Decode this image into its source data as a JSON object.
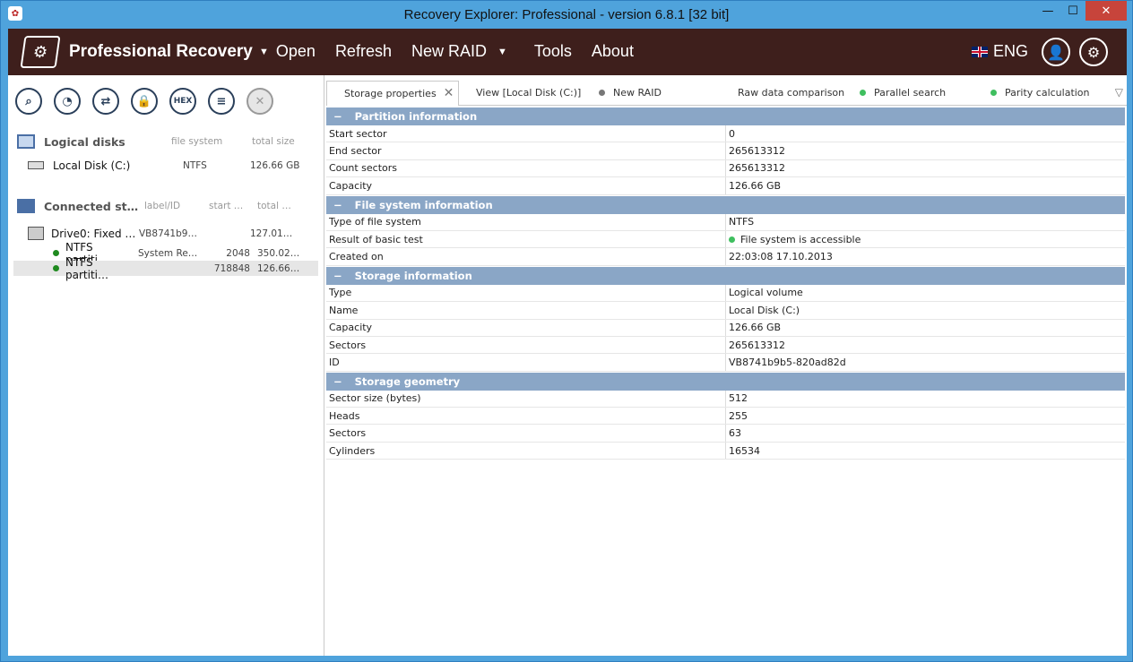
{
  "window": {
    "title": "Recovery Explorer: Professional - version 6.8.1 [32 bit]",
    "minimize_glyph": "—",
    "maximize_glyph": "☐",
    "close_glyph": "✕"
  },
  "header": {
    "brand": "Professional Recovery",
    "menu": [
      {
        "label": "Open",
        "caret": "▼"
      },
      {
        "label": "Refresh",
        "caret": ""
      },
      {
        "label": "New RAID",
        "caret": "▼"
      },
      {
        "label": "Tools",
        "caret": ""
      },
      {
        "label": "About",
        "caret": ""
      }
    ],
    "language": "ENG",
    "user_glyph": "👤",
    "settings_glyph": "⚙"
  },
  "toolbar": {
    "hex_label": "HEX",
    "search_glyph": "⌕",
    "scan_glyph": "◔",
    "image_glyph": "⇄",
    "lock_glyph": "🔒",
    "list_glyph": "≡",
    "close_glyph": "✕"
  },
  "logical": {
    "title": "Logical disks",
    "col_fs": "file system",
    "col_size": "total size",
    "items": [
      {
        "name": "Local Disk (C:)",
        "fs": "NTFS",
        "size": "126.66 GB"
      }
    ]
  },
  "connected": {
    "title": "Connected st…",
    "col_label": "label/ID",
    "col_start": "start …",
    "col_total": "total …",
    "drive": {
      "name": "Drive0: Fixed …",
      "label": "VB8741b9…",
      "total": "127.01…"
    },
    "partitions": [
      {
        "name": "NTFS partiti…",
        "label": "System Re…",
        "start": "2048",
        "total": "350.02…"
      },
      {
        "name": "NTFS partiti…",
        "label": "",
        "start": "718848",
        "total": "126.66…"
      }
    ]
  },
  "tabs": [
    {
      "label": "Storage properties",
      "dot": "#777777",
      "closable": true
    },
    {
      "label": "View [Local Disk (C:)]",
      "dot": "#3fbf5f",
      "closable": false
    },
    {
      "label": "New RAID",
      "dot": "#777777",
      "closable": false
    },
    {
      "label": "Raw data comparison",
      "dot": "#3fbf5f",
      "closable": false
    },
    {
      "label": "Parallel search",
      "dot": "#3fbf5f",
      "closable": false
    },
    {
      "label": "Parity calculation",
      "dot": "#3fbf5f",
      "closable": false
    }
  ],
  "tab_menu_glyph": "▽",
  "groups": [
    {
      "title": "Partition information",
      "rows": [
        {
          "k": "Start sector",
          "v": "0"
        },
        {
          "k": "End sector",
          "v": "265613312"
        },
        {
          "k": "Count sectors",
          "v": "265613312"
        },
        {
          "k": "Capacity",
          "v": "126.66 GB"
        }
      ]
    },
    {
      "title": "File system information",
      "rows": [
        {
          "k": "Type of file system",
          "v": "NTFS"
        },
        {
          "k": "Result of basic test",
          "v": "File system is accessible",
          "status": true
        },
        {
          "k": "Created on",
          "v": "22:03:08 17.10.2013"
        }
      ]
    },
    {
      "title": "Storage information",
      "rows": [
        {
          "k": "Type",
          "v": "Logical volume"
        },
        {
          "k": "Name",
          "v": "Local Disk (C:)"
        },
        {
          "k": "Capacity",
          "v": "126.66 GB"
        },
        {
          "k": "Sectors",
          "v": "265613312"
        },
        {
          "k": "ID",
          "v": "VB8741b9b5-820ad82d"
        }
      ]
    },
    {
      "title": "Storage geometry",
      "rows": [
        {
          "k": "Sector size (bytes)",
          "v": "512"
        },
        {
          "k": "Heads",
          "v": "255"
        },
        {
          "k": "Sectors",
          "v": "63"
        },
        {
          "k": "Cylinders",
          "v": "16534"
        }
      ]
    }
  ]
}
